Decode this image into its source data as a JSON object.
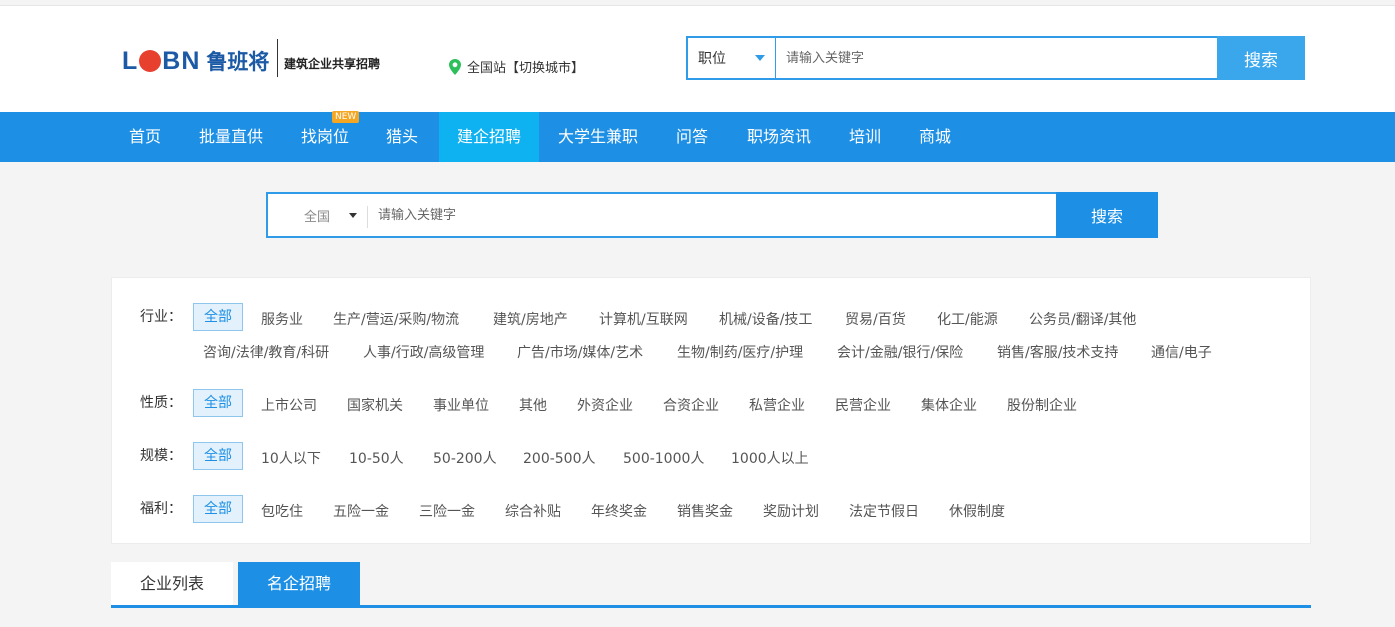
{
  "header": {
    "logo_text_a": "L",
    "logo_text_b": "BN",
    "logo_cn": "鲁班将",
    "slogan": "建筑企业共享招聘",
    "location": "全国站【切换城市】"
  },
  "top_search": {
    "select_value": "职位",
    "placeholder": "请输入关键字",
    "button": "搜索"
  },
  "nav": {
    "items": [
      {
        "label": "首页"
      },
      {
        "label": "批量直供"
      },
      {
        "label": "找岗位",
        "badge": "NEW"
      },
      {
        "label": "猎头"
      },
      {
        "label": "建企招聘"
      },
      {
        "label": "大学生兼职"
      },
      {
        "label": "问答"
      },
      {
        "label": "职场资讯"
      },
      {
        "label": "培训"
      },
      {
        "label": "商城"
      }
    ]
  },
  "main_search": {
    "region": "全国",
    "placeholder": "请输入关键字",
    "button": "搜索"
  },
  "filters": {
    "industry": {
      "label": "行业：",
      "options": [
        "全部",
        "服务业",
        "生产/营运/采购/物流",
        "建筑/房地产",
        "计算机/互联网",
        "机械/设备/技工",
        "贸易/百货",
        "化工/能源",
        "公务员/翻译/其他",
        "咨询/法律/教育/科研",
        "人事/行政/高级管理",
        "广告/市场/媒体/艺术",
        "生物/制药/医疗/护理",
        "会计/金融/银行/保险",
        "销售/客服/技术支持",
        "通信/电子"
      ]
    },
    "nature": {
      "label": "性质：",
      "options": [
        "全部",
        "上市公司",
        "国家机关",
        "事业单位",
        "其他",
        "外资企业",
        "合资企业",
        "私营企业",
        "民营企业",
        "集体企业",
        "股份制企业"
      ]
    },
    "scale": {
      "label": "规模：",
      "options": [
        "全部",
        "10人以下",
        "10-50人",
        "50-200人",
        "200-500人",
        "500-1000人",
        "1000人以上"
      ]
    },
    "welfare": {
      "label": "福利：",
      "options": [
        "全部",
        "包吃住",
        "五险一金",
        "三险一金",
        "综合补贴",
        "年终奖金",
        "销售奖金",
        "奖励计划",
        "法定节假日",
        "休假制度"
      ]
    }
  },
  "tabs": {
    "list": "企业列表",
    "famous": "名企招聘"
  },
  "colors": {
    "brand_blue": "#1d90e6",
    "active_nav": "#0fb2f0",
    "logo_red": "#e8402f",
    "badge_orange": "#f5a623"
  }
}
